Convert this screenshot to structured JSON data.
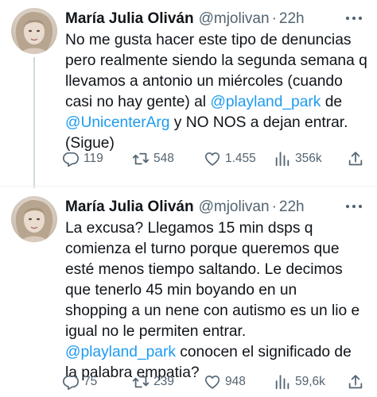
{
  "tweets": [
    {
      "author": {
        "name": "María Julia Oliván",
        "handle": "@mjolivan",
        "separator": "·",
        "time": "22h"
      },
      "text_lines": [
        {
          "parts": [
            {
              "text": "No me gusta hacer este tipo de denuncias"
            }
          ]
        },
        {
          "parts": [
            {
              "text": "pero realmente siendo la segunda semana q"
            }
          ]
        },
        {
          "parts": [
            {
              "text": "llevamos a antonio un miércoles (cuando"
            }
          ]
        },
        {
          "parts": [
            {
              "text": "casi no hay gente) al "
            },
            {
              "text": "@playland_park",
              "mention": true
            },
            {
              "text": " de"
            }
          ]
        },
        {
          "parts": [
            {
              "text": "@UnicenterArg",
              "mention": true
            },
            {
              "text": " y NO NOS a dejan entrar."
            }
          ]
        },
        {
          "parts": [
            {
              "text": "(Sigue)"
            }
          ]
        }
      ],
      "stats": {
        "replies": "119",
        "retweets": "548",
        "likes": "1.455",
        "views": "356k"
      }
    },
    {
      "author": {
        "name": "María Julia Oliván",
        "handle": "@mjolivan",
        "separator": "·",
        "time": "22h"
      },
      "text_lines": [
        {
          "parts": [
            {
              "text": "La excusa? Llegamos 15 min dsps q"
            }
          ]
        },
        {
          "parts": [
            {
              "text": "comienza el turno porque queremos que"
            }
          ]
        },
        {
          "parts": [
            {
              "text": "esté menos tiempo saltando. Le decimos"
            }
          ]
        },
        {
          "parts": [
            {
              "text": "que tenerlo 45 min boyando en un"
            }
          ]
        },
        {
          "parts": [
            {
              "text": "shopping a un nene con autismo es un lio e"
            }
          ]
        },
        {
          "parts": [
            {
              "text": "igual no le permiten entrar."
            }
          ]
        },
        {
          "parts": [
            {
              "text": "@playland_park",
              "mention": true
            },
            {
              "text": " conocen el significado de"
            }
          ]
        },
        {
          "parts": [
            {
              "text": "la palabra empatia?"
            }
          ]
        }
      ],
      "stats": {
        "replies": "75",
        "retweets": "239",
        "likes": "948",
        "views": "59,6k"
      }
    }
  ],
  "icons": {
    "reply": "reply-icon",
    "retweet": "retweet-icon",
    "like": "heart-icon",
    "views": "views-icon",
    "share": "share-icon",
    "more": "more-icon"
  },
  "colors": {
    "text": "#0f1419",
    "secondary": "#536471",
    "mention": "#1d9bf0",
    "thread_line": "#cfd9de"
  }
}
